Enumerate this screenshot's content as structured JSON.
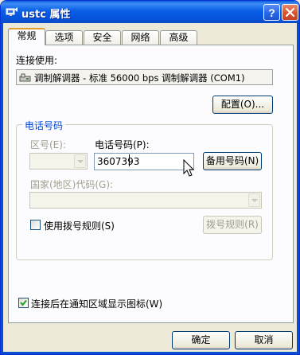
{
  "window": {
    "title": "ustc 属性",
    "help_btn": "?",
    "close_btn": "✕"
  },
  "tabs": [
    "常规",
    "选项",
    "安全",
    "网络",
    "高级"
  ],
  "general": {
    "connect_using_label": "连接使用:",
    "modem_name": "调制解调器 - 标准 56000 bps 调制解调器 (COM1)",
    "configure_button": "配置(O)...",
    "phone_group_label": "电话号码",
    "area_code_label": "区号(E):",
    "phone_number_label": "电话号码(P):",
    "phone_number_value": "3607393",
    "alternates_button": "备用号码(N)",
    "country_code_label": "国家(地区)代码(G):",
    "use_dialing_rules_label": "使用拨号规则(S)",
    "dialing_rules_button": "拨号规则(R)",
    "show_icon_label": "连接后在通知区域显示图标(W)",
    "show_icon_checked": true,
    "use_dialing_rules_checked": false
  },
  "footer": {
    "ok_button": "确定",
    "cancel_button": "取消"
  }
}
